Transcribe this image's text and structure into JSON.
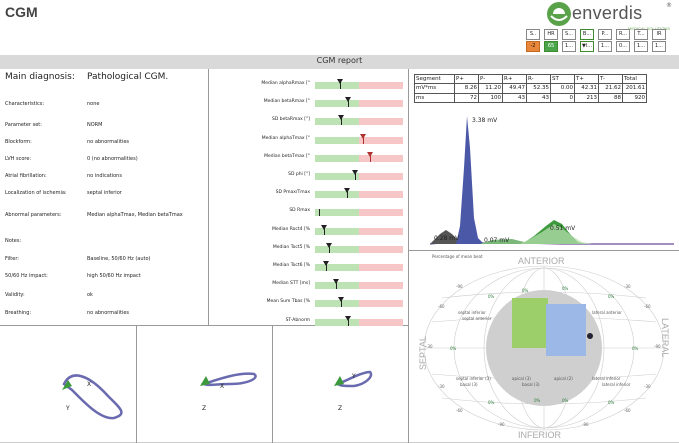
{
  "app": {
    "title": "CGM"
  },
  "logo": {
    "name": "enverdis",
    "sub": "MEDICAL SOLUTIONS",
    "reg": "®"
  },
  "metrics": [
    {
      "label": "S..",
      "value": "-2",
      "style": "o"
    },
    {
      "label": "HR",
      "value": "65",
      "style": "gf"
    },
    {
      "label": "S...",
      "value": "1...",
      "style": "n"
    },
    {
      "label": "B...",
      "value": "▼I...",
      "style": "g"
    },
    {
      "label": "P...",
      "value": "1...",
      "style": "n"
    },
    {
      "label": "R...",
      "value": "0...",
      "style": "n"
    },
    {
      "label": "T...",
      "value": "1...",
      "style": "n"
    },
    {
      "label": "IR",
      "value": "1...",
      "style": "n"
    },
    {
      "label": "S...",
      "value": "1...",
      "style": "n"
    }
  ],
  "report": {
    "title": "CGM report"
  },
  "diagnosis": {
    "main_label": "Main diagnosis:",
    "main_value": "Pathological CGM.",
    "rows": [
      {
        "label": "Characteristics:",
        "value": "none"
      },
      {
        "label": "Parameter set:",
        "value": "NORM"
      },
      {
        "label": "Blockform:",
        "value": "no abnormalities"
      },
      {
        "label": "LVH score:",
        "value": "0 (no abnormalities)"
      },
      {
        "label": "Atrial fibrillation:",
        "value": "no indications"
      },
      {
        "label": "Localization of ischemia:",
        "value": "septal inferior"
      },
      {
        "label": "Abnormal parameters:",
        "value": "Median alphaTmax, Median betaTmax"
      },
      {
        "label": "Notes:",
        "value": ""
      },
      {
        "label": "Filter:",
        "value": "Baseline, 50/60 Hz (auto)"
      },
      {
        "label": "50/60 Hz impact:",
        "value": "high 50/60 Hz impact"
      },
      {
        "label": "Validity:",
        "value": "ok"
      },
      {
        "label": "Breathing:",
        "value": "no abnormalities"
      }
    ]
  },
  "params": [
    {
      "label": "Median alphaRmax [°",
      "level": 0.28,
      "mark": "triangle",
      "color": "#222"
    },
    {
      "label": "Median betaRmax [°",
      "level": 0.38,
      "mark": "triangle",
      "color": "#222"
    },
    {
      "label": "SD betaRmax [°]",
      "level": 0.3,
      "mark": "triangle",
      "color": "#222"
    },
    {
      "label": "Median alphaTmax [°",
      "level": 0.55,
      "mark": "triangle",
      "color": "#b03030"
    },
    {
      "label": "Median betaTmax [°",
      "level": 0.62,
      "mark": "triangle",
      "color": "#b03030"
    },
    {
      "label": "SD phi [°]",
      "level": 0.46,
      "mark": "triangle",
      "color": "#222"
    },
    {
      "label": "SD Pmax/Tmax",
      "level": 0.36,
      "mark": "triangle",
      "color": "#222"
    },
    {
      "label": "SD Rmax",
      "level": 0.04,
      "mark": "line",
      "color": "#222"
    },
    {
      "label": "Median Roct4 [%",
      "level": 0.1,
      "mark": "triangle",
      "color": "#222"
    },
    {
      "label": "Median Toct5 [%",
      "level": 0.16,
      "mark": "triangle",
      "color": "#222"
    },
    {
      "label": "Median Toct6 [%",
      "level": 0.12,
      "mark": "triangle",
      "color": "#222"
    },
    {
      "label": "Median STT [ms]",
      "level": 0.24,
      "mark": "triangle",
      "color": "#222"
    },
    {
      "label": "Mean Sum Tbas [%",
      "level": 0.3,
      "mark": "triangle",
      "color": "#222"
    },
    {
      "label": "ST-Abnorm",
      "level": 0.38,
      "mark": "triangle",
      "color": "#222"
    }
  ],
  "segments": {
    "headers": [
      "Segment",
      "P+",
      "P-",
      "R+",
      "R-",
      "ST",
      "T+",
      "T-",
      "Total"
    ],
    "rows": [
      {
        "label": "mV*ms",
        "values": [
          "8.26",
          "11.20",
          "49.47",
          "52.35",
          "0.00",
          "42.31",
          "21.62",
          "201.61"
        ]
      },
      {
        "label": "ms",
        "values": [
          "72",
          "100",
          "43",
          "43",
          "0",
          "213",
          "88",
          "920"
        ]
      }
    ]
  },
  "wave": {
    "peak_r": "3.38 mV",
    "peak_t": "0.51 mV",
    "peak_p": "0.28 mV",
    "peak_q": "0.07 mV"
  },
  "polar": {
    "note": "Percentage of mean beat",
    "anterior": "ANTERIOR",
    "inferior": "INFERIOR",
    "septal": "SEPTAL",
    "lateral": "LATERAL",
    "region_labels": [
      "septal inferior",
      "septal anterior",
      "lateral anterior",
      "lateral inferior",
      "septal inferior (3)",
      "apical (3)",
      "apical (2)",
      "lateral inferior",
      "basal (3)",
      "basal (3)"
    ],
    "percent_labels": [
      "0%",
      "0%",
      "0%",
      "0%",
      "0%",
      "0%",
      "0%",
      "0%",
      "0%",
      "0%"
    ],
    "scale_labels": [
      "-90",
      "-60",
      "-30",
      "-30",
      "-60",
      "-90",
      "-30",
      "-60",
      "-90",
      "-30",
      "-60",
      "-90"
    ]
  },
  "loops": [
    {
      "axes": [
        "X",
        "Y"
      ]
    },
    {
      "axes": [
        "X",
        "Z"
      ]
    },
    {
      "axes": [
        "Y",
        "Z"
      ]
    }
  ]
}
